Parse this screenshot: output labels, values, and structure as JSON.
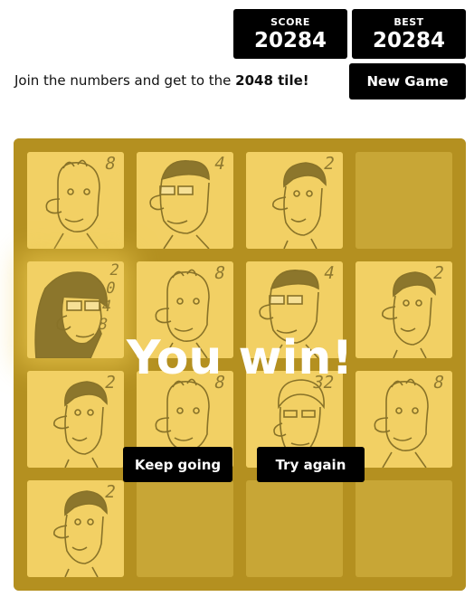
{
  "header": {
    "score_label": "SCORE",
    "score_value": "20284",
    "best_label": "BEST",
    "best_value": "20284",
    "intro_prefix": "Join the numbers and get to the ",
    "intro_bold": "2048 tile!",
    "new_game_label": "New Game"
  },
  "board": {
    "rows": [
      [
        "8",
        "4",
        "2",
        ""
      ],
      [
        "2048",
        "8",
        "4",
        "2"
      ],
      [
        "2",
        "8",
        "32",
        "8"
      ],
      [
        "2",
        "",
        "",
        ""
      ]
    ]
  },
  "overlay": {
    "message": "You win!",
    "keep_going_label": "Keep going",
    "try_again_label": "Try again"
  },
  "colors": {
    "board": "#7a5f13",
    "empty_cell": "#a38a3e",
    "tile": "#f6df9a",
    "overlay": "#edc22e"
  }
}
